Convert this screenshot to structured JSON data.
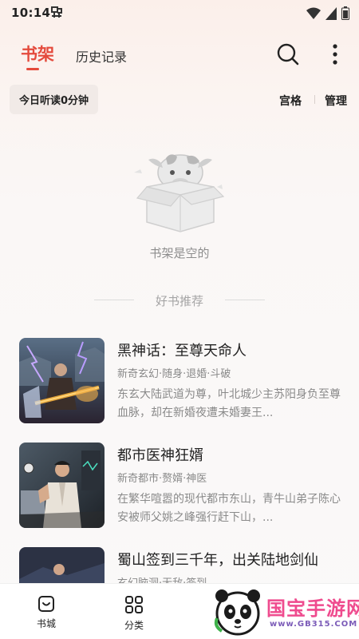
{
  "status_bar": {
    "time": "10:14"
  },
  "header": {
    "tab_active": "书架",
    "tab_history": "历史记录"
  },
  "toolbar": {
    "reading_today": "今日听读0分钟",
    "view_grid": "宫格",
    "view_manage": "管理"
  },
  "empty_state": {
    "text": "书架是空的"
  },
  "recommend": {
    "title": "好书推荐",
    "books": [
      {
        "title": "黑神话：至尊天命人",
        "tags": "新奇玄幻·随身·退婚·斗破",
        "desc": "东玄大陆武道为尊，叶北城少主苏阳身负至尊血脉，却在新婚夜遭未婚妻王..."
      },
      {
        "title": "都市医神狂婿",
        "tags": "新奇都市·赘婿·神医",
        "desc": "在繁华喧嚣的现代都市东山，青牛山弟子陈心安被师父姚之峰强行赶下山，..."
      },
      {
        "title": "蜀山签到三千年，出关陆地剑仙",
        "tags": "玄幻脑洞·无敌·签到",
        "desc": ""
      }
    ]
  },
  "bottom_nav": {
    "items": [
      {
        "label": "书城",
        "icon": "store-icon"
      },
      {
        "label": "分类",
        "icon": "category-icon"
      }
    ]
  },
  "watermark": {
    "text": "国宝手游网",
    "url": "www.GB315.COM"
  },
  "colors": {
    "accent": "#e44a3c",
    "muted_text": "#8a8a8a",
    "watermark_pink": "#ef4b8e"
  }
}
